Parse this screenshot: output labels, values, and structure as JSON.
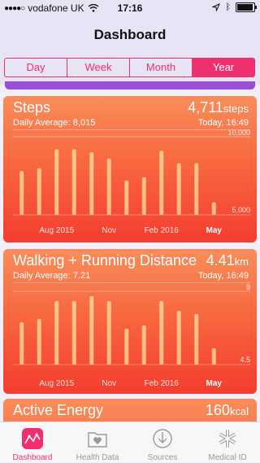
{
  "status": {
    "carrier": "vodafone UK",
    "time": "17:16"
  },
  "nav": {
    "title": "Dashboard"
  },
  "segments": [
    "Day",
    "Week",
    "Month",
    "Year"
  ],
  "active_segment": "Year",
  "cards": [
    {
      "title": "Steps",
      "value": "4,711",
      "unit": "steps",
      "subtitle": "Daily Average: 8,015",
      "time": "Today, 16:49",
      "y_top_label": "10,000",
      "y_bottom_label": "5,000"
    },
    {
      "title": "Walking + Running Distance",
      "value": "4.41",
      "unit": "km",
      "subtitle": "Daily Average: 7.21",
      "time": "Today, 16:49",
      "y_top_label": "9",
      "y_bottom_label": "4.5"
    },
    {
      "title": "Active Energy",
      "value": "160",
      "unit": "kcal"
    }
  ],
  "chart_data": [
    {
      "type": "bar",
      "title": "Steps",
      "x_labels": [
        "Aug 2015",
        "Nov",
        "Feb 2016",
        "May"
      ],
      "values": [
        7800,
        8000,
        9200,
        9200,
        9000,
        8600,
        7200,
        7400,
        9100,
        8300,
        8300,
        5800
      ],
      "ylim": [
        5000,
        10000
      ],
      "yticks": [
        "10,000",
        "5,000"
      ]
    },
    {
      "type": "bar",
      "title": "Walking + Running Distance",
      "x_labels": [
        "Aug 2015",
        "Nov",
        "Feb 2016",
        "May"
      ],
      "values": [
        7.1,
        7.3,
        8.4,
        8.4,
        8.7,
        8.4,
        6.7,
        6.9,
        8.4,
        7.8,
        7.6,
        5.5
      ],
      "ylim": [
        4.5,
        9
      ],
      "yticks": [
        "9",
        "4.5"
      ]
    }
  ],
  "tabs": [
    {
      "label": "Dashboard",
      "icon": "dashboard-icon"
    },
    {
      "label": "Health Data",
      "icon": "health-data-icon"
    },
    {
      "label": "Sources",
      "icon": "sources-icon"
    },
    {
      "label": "Medical ID",
      "icon": "medical-id-icon"
    }
  ],
  "colors": {
    "accent": "#f0306e",
    "card_top": "#f98d5b",
    "card_bottom": "#f43d2f",
    "purple": "#9b4fd6"
  }
}
